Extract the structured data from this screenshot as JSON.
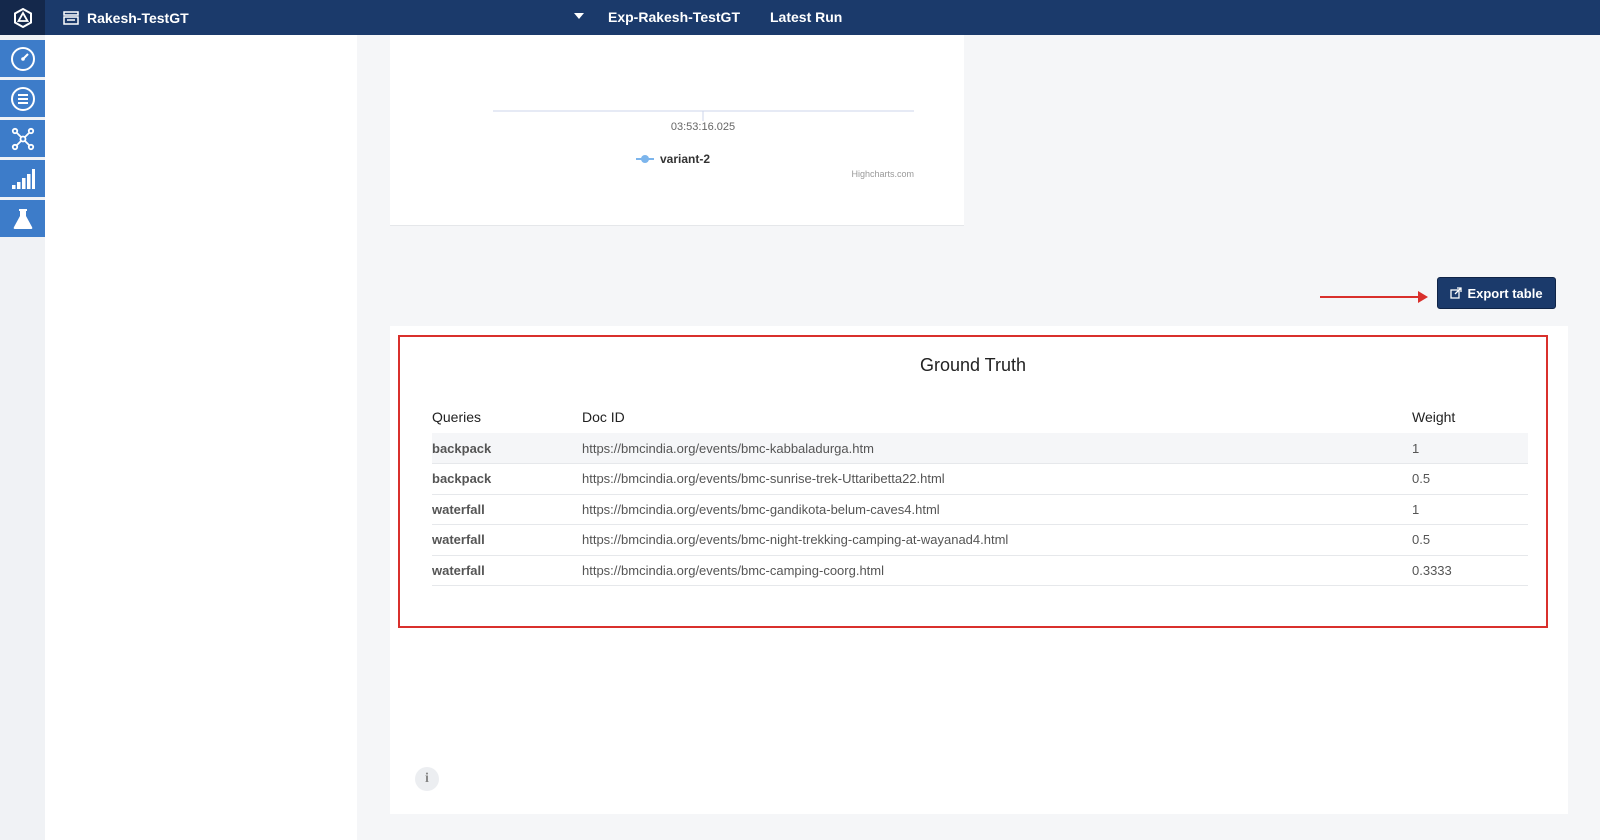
{
  "header": {
    "project_name": "Rakesh-TestGT",
    "experiment_name": "Exp-Rakesh-TestGT",
    "latest_run_label": "Latest Run"
  },
  "sidebar": {
    "items": [
      {
        "icon": "dashboard-gauge-icon"
      },
      {
        "icon": "list-icon"
      },
      {
        "icon": "network-icon"
      },
      {
        "icon": "signal-bars-icon"
      },
      {
        "icon": "flask-icon"
      }
    ]
  },
  "chart_data": {
    "type": "line",
    "x": [
      "03:53:16.025"
    ],
    "series": [
      {
        "name": "variant-2",
        "values": [
          null
        ]
      }
    ],
    "credit": "Highcharts.com",
    "legend_position": "bottom-center",
    "color": "#7cb5ec"
  },
  "export": {
    "label": "Export table"
  },
  "ground_truth": {
    "title": "Ground Truth",
    "columns": [
      "Queries",
      "Doc ID",
      "Weight"
    ],
    "rows": [
      {
        "query": "backpack",
        "doc_id": "https://bmcindia.org/events/bmc-kabbaladurga.htm",
        "weight": "1"
      },
      {
        "query": "backpack",
        "doc_id": "https://bmcindia.org/events/bmc-sunrise-trek-Uttaribetta22.html",
        "weight": "0.5"
      },
      {
        "query": "waterfall",
        "doc_id": "https://bmcindia.org/events/bmc-gandikota-belum-caves4.html",
        "weight": "1"
      },
      {
        "query": "waterfall",
        "doc_id": "https://bmcindia.org/events/bmc-night-trekking-camping-at-wayanad4.html",
        "weight": "0.5"
      },
      {
        "query": "waterfall",
        "doc_id": "https://bmcindia.org/events/bmc-camping-coorg.html",
        "weight": "0.3333"
      }
    ]
  },
  "colors": {
    "navbar": "#1b3a6b",
    "sidebar_button": "#3d7cc9",
    "highlight": "#d9302c"
  }
}
